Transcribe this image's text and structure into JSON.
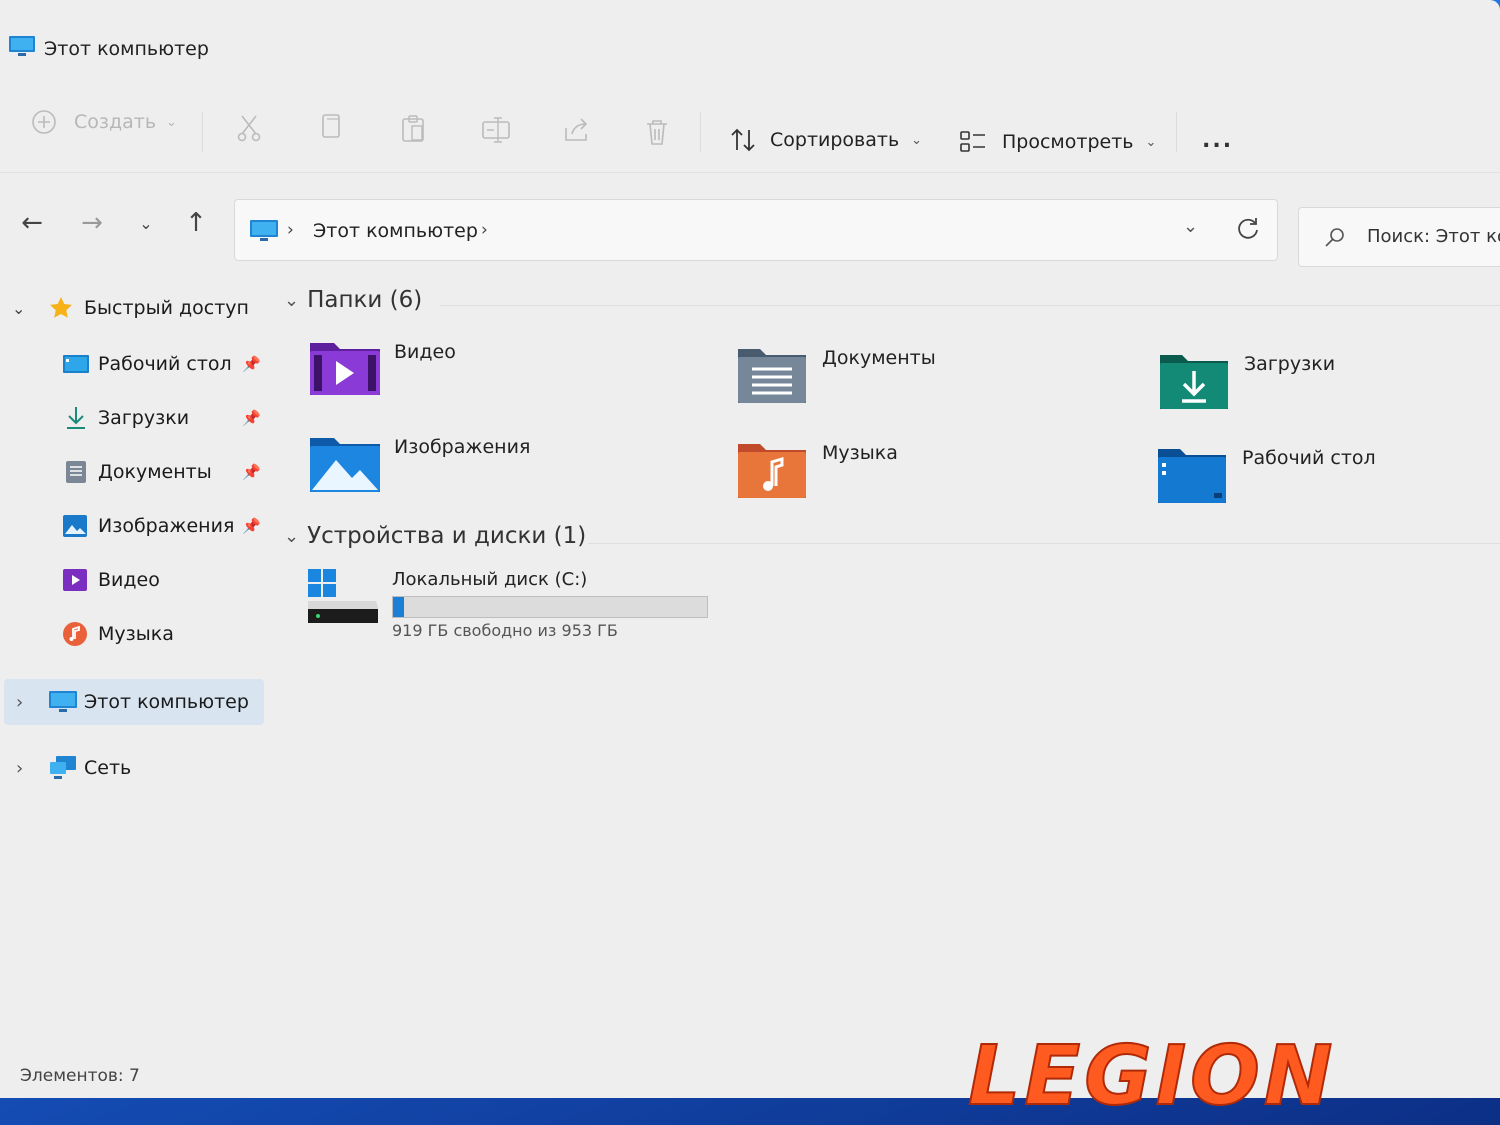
{
  "window": {
    "title": "Этот компьютер"
  },
  "toolbar": {
    "create_label": "Создать",
    "sort_label": "Сортировать",
    "view_label": "Просмотреть",
    "more_label": "..."
  },
  "address": {
    "crumb": "Этот компьютер",
    "search_placeholder": "Поиск: Этот ко"
  },
  "sidebar": {
    "quick_access": "Быстрый доступ",
    "items": [
      {
        "label": "Рабочий стол",
        "pinned": true,
        "icon": "desktop-icon"
      },
      {
        "label": "Загрузки",
        "pinned": true,
        "icon": "downloads-icon"
      },
      {
        "label": "Документы",
        "pinned": true,
        "icon": "documents-icon"
      },
      {
        "label": "Изображения",
        "pinned": true,
        "icon": "pictures-icon"
      },
      {
        "label": "Видео",
        "pinned": false,
        "icon": "video-icon"
      },
      {
        "label": "Музыка",
        "pinned": false,
        "icon": "music-icon"
      }
    ],
    "this_pc": "Этот компьютер",
    "network": "Сеть"
  },
  "content": {
    "folders_header": "Папки (6)",
    "folders": [
      {
        "label": "Видео",
        "icon": "video-folder-icon"
      },
      {
        "label": "Документы",
        "icon": "documents-folder-icon"
      },
      {
        "label": "Загрузки",
        "icon": "downloads-folder-icon"
      },
      {
        "label": "Изображения",
        "icon": "pictures-folder-icon"
      },
      {
        "label": "Музыка",
        "icon": "music-folder-icon"
      },
      {
        "label": "Рабочий стол",
        "icon": "desktop-folder-icon"
      }
    ],
    "devices_header": "Устройства и диски (1)",
    "drive": {
      "label": "Локальный диск (C:)",
      "free_text": "919 ГБ свободно из 953 ГБ",
      "used_fraction": 0.036
    }
  },
  "status": {
    "items_text": "Элементов: 7"
  },
  "watermark": {
    "text": "LEGION"
  },
  "colors": {
    "accent": "#1c7fd6",
    "selection": "#d8e4f0",
    "watermark": "#ff5a1f"
  }
}
